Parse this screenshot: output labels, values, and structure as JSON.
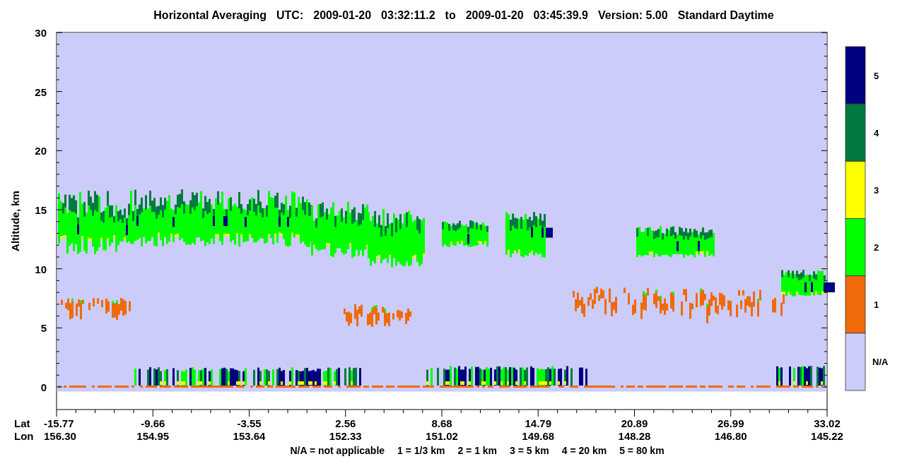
{
  "title": [
    "Horizontal Averaging",
    "UTC:",
    "2009-01-20",
    "03:32:11.2",
    "to",
    "2009-01-20",
    "03:45:39.9",
    "Version: 5.00",
    "Standard Daytime"
  ],
  "y_axis": {
    "label": "Altitude, km",
    "ticks": [
      "30",
      "25",
      "20",
      "15",
      "10",
      "5",
      "0"
    ]
  },
  "x_axis": {
    "row_labels": [
      "Lat",
      "Lon"
    ],
    "columns": [
      {
        "lat": "-15.77",
        "lon": "156.30"
      },
      {
        "lat": "-9.66",
        "lon": "154.95"
      },
      {
        "lat": "-3.55",
        "lon": "153.64"
      },
      {
        "lat": "2.56",
        "lon": "152.33"
      },
      {
        "lat": "8.68",
        "lon": "151.02"
      },
      {
        "lat": "14.79",
        "lon": "149.68"
      },
      {
        "lat": "20.89",
        "lon": "148.28"
      },
      {
        "lat": "26.99",
        "lon": "146.80"
      },
      {
        "lat": "33.02",
        "lon": "145.22"
      }
    ]
  },
  "colorbar": [
    {
      "label": "5",
      "color": "#000080"
    },
    {
      "label": "4",
      "color": "#007a40"
    },
    {
      "label": "3",
      "color": "#ffff00"
    },
    {
      "label": "2",
      "color": "#00ff00"
    },
    {
      "label": "1",
      "color": "#f06a0a"
    },
    {
      "label": "N/A",
      "color": "#ccccfa"
    }
  ],
  "legend": [
    "N/A = not applicable",
    "1 = 1/3 km",
    "2 = 1 km",
    "3 = 5 km",
    "4 = 20 km",
    "5 = 80 km"
  ]
}
